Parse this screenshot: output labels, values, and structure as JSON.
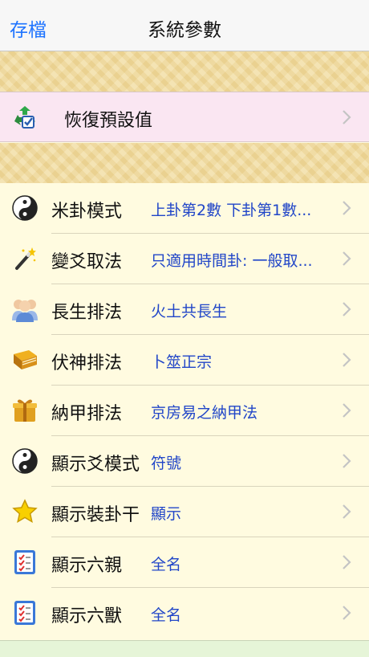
{
  "nav": {
    "left_label": "存檔",
    "title": "系統參數"
  },
  "reset_row": {
    "label": "恢復預設值",
    "icon": "recycle-reset-icon"
  },
  "settings": [
    {
      "label": "米卦模式",
      "value": "上卦第2數 下卦第1數...",
      "icon": "yin-yang-icon"
    },
    {
      "label": "變爻取法",
      "value": "只適用時間卦: 一般取...",
      "icon": "magic-wand-icon"
    },
    {
      "label": "長生排法",
      "value": "火土共長生",
      "icon": "people-icon"
    },
    {
      "label": "伏神排法",
      "value": "卜筮正宗",
      "icon": "book-icon"
    },
    {
      "label": "納甲排法",
      "value": "京房易之納甲法",
      "icon": "gift-box-icon"
    },
    {
      "label": "顯示爻模式",
      "value": "符號",
      "icon": "yin-yang-icon"
    },
    {
      "label": "顯示裝卦干",
      "value": "顯示",
      "icon": "star-icon"
    },
    {
      "label": "顯示六親",
      "value": "全名",
      "icon": "checklist-icon"
    },
    {
      "label": "顯示六獸",
      "value": "全名",
      "icon": "checklist-icon"
    }
  ],
  "colors": {
    "accent": "#1f74ff",
    "value_text": "#2146c8",
    "row_bg": "#fffbe0",
    "reset_bg": "#fae6f2"
  }
}
